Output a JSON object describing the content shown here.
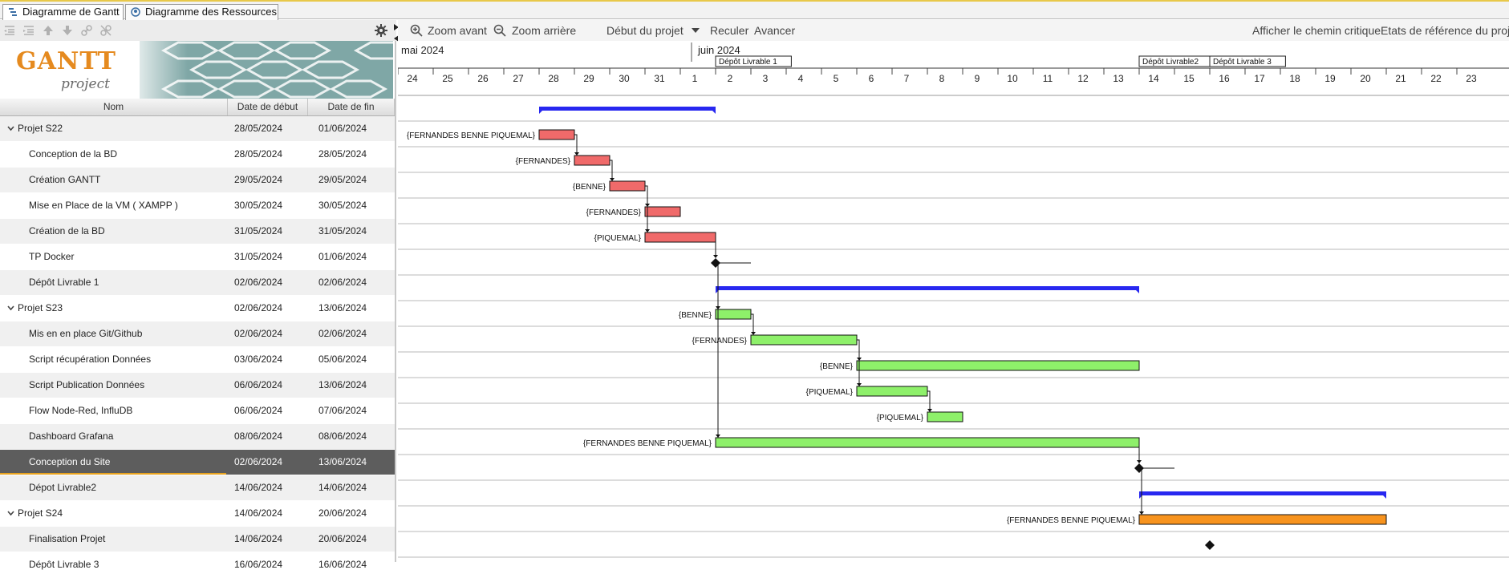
{
  "tabs": [
    {
      "label": "Diagramme de Gantt",
      "active": true
    },
    {
      "label": "Diagramme des Ressources",
      "active": false
    }
  ],
  "logo": {
    "main": "GANTT",
    "sub": "project"
  },
  "columns": {
    "name": "Nom",
    "start": "Date de début",
    "end": "Date de fin"
  },
  "toolbar": {
    "zoom_in": "Zoom avant",
    "zoom_out": "Zoom arrière",
    "project_start": "Début du projet",
    "back": "Reculer",
    "forward": "Avancer",
    "critical_path": "Afficher le chemin critique",
    "baselines": "Etats de référence du projet"
  },
  "timeline": {
    "months": [
      "mai 2024",
      "juin 2024"
    ],
    "days": [
      "24",
      "25",
      "26",
      "27",
      "28",
      "29",
      "30",
      "31",
      "1",
      "2",
      "3",
      "4",
      "5",
      "6",
      "7",
      "8",
      "9",
      "10",
      "11",
      "12",
      "13",
      "14",
      "15",
      "16",
      "17",
      "18",
      "19",
      "20",
      "21",
      "22",
      "23"
    ],
    "milestone_labels": [
      "Dépôt Livrable 1",
      "Dépôt Livrable2",
      "Dépôt Livrable 3"
    ]
  },
  "colors": {
    "phase1": "#f06a6a",
    "phase2": "#8ef06a",
    "phase3": "#f7931e",
    "summary": "#2828f0",
    "selected_row": "#5d5d5d"
  },
  "tasks": [
    {
      "name": "Projet S22",
      "start": "28/05/2024",
      "end": "01/06/2024",
      "summary": true
    },
    {
      "name": "Conception de la BD",
      "start": "28/05/2024",
      "end": "28/05/2024",
      "resource": "{FERNANDES BENNE PIQUEMAL}"
    },
    {
      "name": "Création GANTT",
      "start": "29/05/2024",
      "end": "29/05/2024",
      "resource": "{FERNANDES}"
    },
    {
      "name": "Mise en Place de la VM ( XAMPP )",
      "start": "30/05/2024",
      "end": "30/05/2024",
      "resource": "{BENNE}"
    },
    {
      "name": "Création de la BD",
      "start": "31/05/2024",
      "end": "31/05/2024",
      "resource": "{FERNANDES}"
    },
    {
      "name": "TP Docker",
      "start": "31/05/2024",
      "end": "01/06/2024",
      "resource": "{PIQUEMAL}"
    },
    {
      "name": "Dépôt Livrable 1",
      "start": "02/06/2024",
      "end": "02/06/2024",
      "milestone": true
    },
    {
      "name": "Projet S23",
      "start": "02/06/2024",
      "end": "13/06/2024",
      "summary": true
    },
    {
      "name": "Mis en en place Git/Github",
      "start": "02/06/2024",
      "end": "02/06/2024",
      "resource": "{BENNE}"
    },
    {
      "name": "Script récupération Données",
      "start": "03/06/2024",
      "end": "05/06/2024",
      "resource": "{FERNANDES}"
    },
    {
      "name": "Script Publication Données",
      "start": "06/06/2024",
      "end": "13/06/2024",
      "resource": "{BENNE}"
    },
    {
      "name": "Flow Node-Red, InfluDB",
      "start": "06/06/2024",
      "end": "07/06/2024",
      "resource": "{PIQUEMAL}"
    },
    {
      "name": "Dashboard Grafana",
      "start": "08/06/2024",
      "end": "08/06/2024",
      "resource": "{PIQUEMAL}"
    },
    {
      "name": "Conception du Site",
      "start": "02/06/2024",
      "end": "13/06/2024",
      "resource": "{FERNANDES BENNE PIQUEMAL}",
      "selected": true
    },
    {
      "name": "Dépot Livrable2",
      "start": "14/06/2024",
      "end": "14/06/2024",
      "milestone": true
    },
    {
      "name": "Projet S24",
      "start": "14/06/2024",
      "end": "20/06/2024",
      "summary": true
    },
    {
      "name": "Finalisation Projet",
      "start": "14/06/2024",
      "end": "20/06/2024",
      "resource": "{FERNANDES BENNE PIQUEMAL}"
    },
    {
      "name": "Dépôt Livrable 3",
      "start": "16/06/2024",
      "end": "16/06/2024",
      "milestone": true
    }
  ]
}
